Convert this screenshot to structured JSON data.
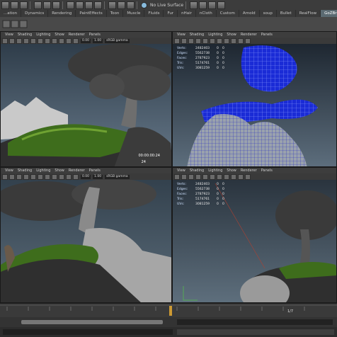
{
  "status": {
    "live_surface": "No Live Surface"
  },
  "shelf_tabs": [
    "...ation",
    "Dynamics",
    "Rendering",
    "PaintEffects",
    "Toon",
    "Muscle",
    "Fluids",
    "Fur",
    "nHair",
    "nCloth",
    "Custom",
    "Arnold",
    "soup",
    "Bullet",
    "RealFlow",
    "GoZBrush"
  ],
  "active_tab": "GoZBrush",
  "viewport_menu": [
    "View",
    "Shading",
    "Lighting",
    "Show",
    "Renderer",
    "Panels"
  ],
  "viewport_fields": {
    "value_a": "0.00",
    "value_b": "1.00",
    "colorspace": "sRGB gamma"
  },
  "hud_labels": [
    "Verts:",
    "Edges:",
    "Faces:",
    "Tris:",
    "UVs:"
  ],
  "hud_values": [
    "2482403",
    "5562738",
    "2787923",
    "5174761",
    "3081259"
  ],
  "hud_zeros": [
    "0",
    "0",
    "0",
    "0",
    "0"
  ],
  "timecode": "00:00:00:24",
  "frame": "24",
  "timeline_end": "1/7",
  "colors": {
    "accent_tab": "#5b6a72",
    "wireframe_blue": "#1a2bd6",
    "hud_label": "#cfe2ff"
  },
  "icons": [
    "file-new-icon",
    "open-icon",
    "save-icon",
    "select-icon",
    "lasso-icon",
    "paint-select-icon",
    "snap-grid-icon",
    "snap-curve-icon",
    "snap-point-icon",
    "render-icon",
    "ipr-icon",
    "render-settings-icon"
  ]
}
